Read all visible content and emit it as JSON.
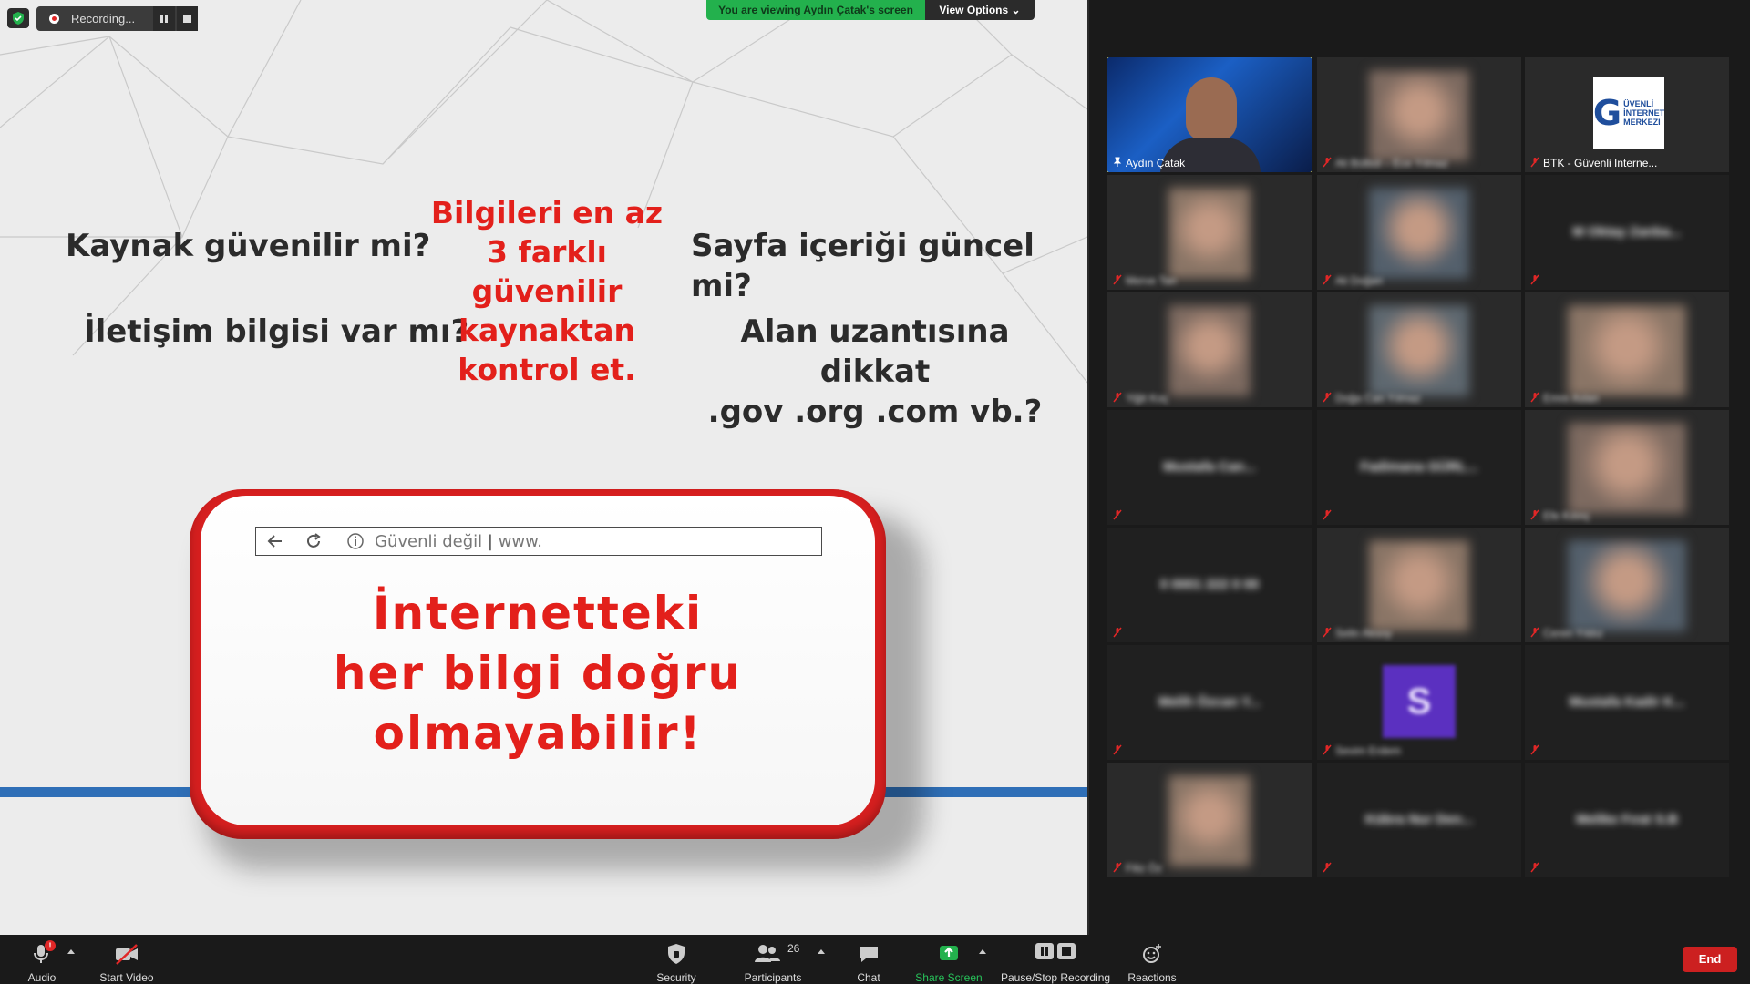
{
  "slide": {
    "q1": "Kaynak güvenilir mi?",
    "q2": "İletişim bilgisi var mı?",
    "q3": "Sayfa içeriği güncel mi?",
    "q4_line1": "Alan uzantısına dikkat",
    "q4_line2": ".gov .org .com vb.?",
    "center_lines": [
      "Bilgileri en az",
      "3 farklı",
      "güvenilir",
      "kaynaktan",
      "kontrol et."
    ],
    "address_bar": {
      "security": "Güvenli değil",
      "separator": "|",
      "url": "www."
    },
    "big_lines": [
      "İnternetteki",
      "her bilgi doğru",
      "olmayabilir!"
    ]
  },
  "overlay": {
    "recording_label": "Recording...",
    "viewing_banner": "You are viewing Aydın Çatak's screen",
    "view_options": "View Options"
  },
  "gallery": {
    "tiles": [
      {
        "name": "Aydın Çatak",
        "type": "video",
        "active": true
      },
      {
        "name": "Ali Bülbül – Ece Yılmaz",
        "type": "video"
      },
      {
        "name": "BTK - Güvenli Interne...",
        "type": "logo"
      },
      {
        "name": "Merve Tan",
        "type": "video"
      },
      {
        "name": "Ali Doğan",
        "type": "video"
      },
      {
        "name": "M Oktay Zanba...",
        "type": "name"
      },
      {
        "name": "Yiğit Koç",
        "type": "video"
      },
      {
        "name": "Doğa Can Yılmaz",
        "type": "video"
      },
      {
        "name": "Emre Aslan",
        "type": "video"
      },
      {
        "name": "Mustafa Can...",
        "type": "name"
      },
      {
        "name": "Fadimana GÜRL...",
        "type": "name"
      },
      {
        "name": "Efe Kılınç",
        "type": "video"
      },
      {
        "name": "0 0001 222 0 00",
        "type": "name"
      },
      {
        "name": "Selin Aksoy",
        "type": "video"
      },
      {
        "name": "Ceren Yıldız",
        "type": "video"
      },
      {
        "name": "Melih Özcan Y...",
        "type": "name"
      },
      {
        "name": "Sevim Erdem",
        "type": "avatar",
        "initial": "S"
      },
      {
        "name": "Mustafa Kadir K...",
        "type": "name"
      },
      {
        "name": "Filiz Öz",
        "type": "video"
      },
      {
        "name": "Kübra Nur Den...",
        "type": "name"
      },
      {
        "name": "Melike Fırat S.B",
        "type": "name"
      }
    ]
  },
  "toolbar": {
    "audio": "Audio",
    "start_video": "Start Video",
    "security": "Security",
    "participants": "Participants",
    "participants_count": "26",
    "chat": "Chat",
    "share_screen": "Share Screen",
    "pause_stop_recording": "Pause/Stop Recording",
    "reactions": "Reactions",
    "end": "End",
    "audio_badge": "!"
  },
  "colors": {
    "accent_red": "#e3201b",
    "banner_green": "#23b14d",
    "active_outline": "#f3e24d",
    "end_red": "#cc2020"
  }
}
